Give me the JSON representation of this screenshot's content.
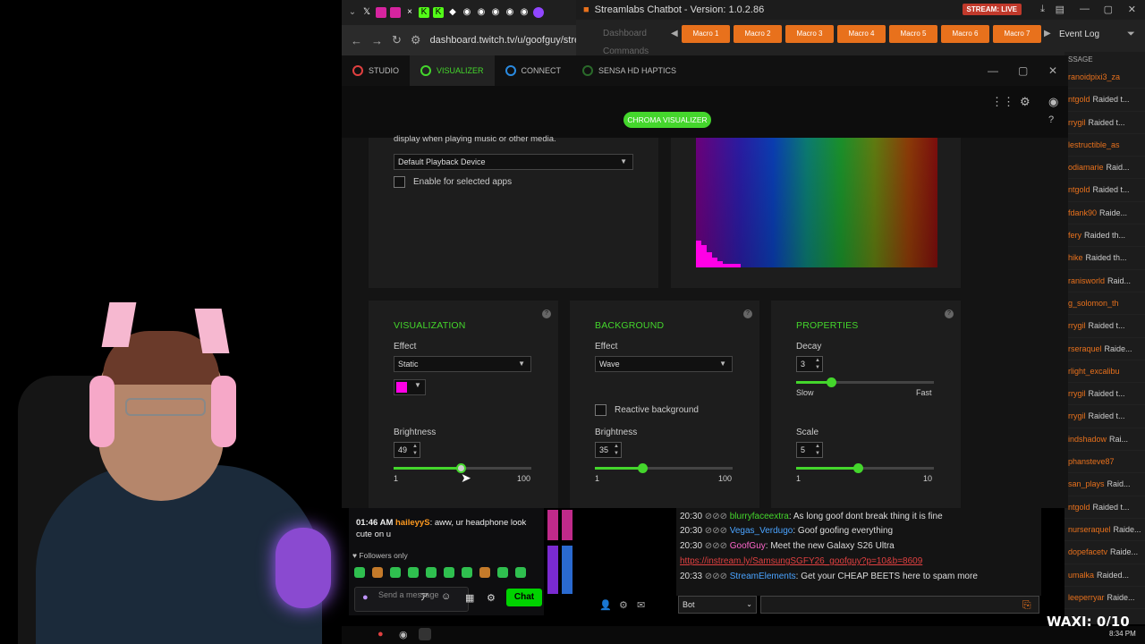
{
  "browser": {
    "url": "dashboard.twitch.tv/u/goofguy/stre"
  },
  "chatbot": {
    "title": "Streamlabs Chatbot - Version: 1.0.2.86",
    "live_badge": "STREAM: LIVE",
    "nav": [
      "Dashboard",
      "Commands"
    ],
    "macros": [
      "Macro 1",
      "Macro 2",
      "Macro 3",
      "Macro 4",
      "Macro 5",
      "Macro 6",
      "Macro 7"
    ],
    "event_log_label": "Event Log",
    "event_header": "SSAGE",
    "events": [
      {
        "name": "ranoidpixi3_za",
        "text": ""
      },
      {
        "name": "ntgold",
        "text": "Raided t..."
      },
      {
        "name": "rrygil",
        "text": "Raided t..."
      },
      {
        "name": "lestructible_as",
        "text": ""
      },
      {
        "name": "odiamarie",
        "text": "Raid..."
      },
      {
        "name": "ntgold",
        "text": "Raided t..."
      },
      {
        "name": "fdank90",
        "text": "Raide..."
      },
      {
        "name": "fery",
        "text": "Raided th..."
      },
      {
        "name": "hike",
        "text": "Raided th..."
      },
      {
        "name": "ranisworld",
        "text": "Raid..."
      },
      {
        "name": "g_solomon_th",
        "text": ""
      },
      {
        "name": "rrygil",
        "text": "Raided t..."
      },
      {
        "name": "rseraquel",
        "text": "Raide..."
      },
      {
        "name": "rlight_excalibu",
        "text": ""
      },
      {
        "name": "rrygil",
        "text": "Raided t..."
      },
      {
        "name": "rrygil",
        "text": "Raided t..."
      },
      {
        "name": "indshadow",
        "text": "Rai..."
      },
      {
        "name": "phansteve87",
        "text": ""
      },
      {
        "name": "san_plays",
        "text": "Raid..."
      },
      {
        "name": "ntgold",
        "text": "Raided t..."
      },
      {
        "name": "nurseraquel",
        "text": "Raide..."
      },
      {
        "name": "dopefacetv",
        "text": "Raide..."
      },
      {
        "name": "umalka",
        "text": "Raided..."
      },
      {
        "name": "leeperryar",
        "text": "Raide..."
      }
    ]
  },
  "synapse": {
    "tabs": [
      "STUDIO",
      "VISUALIZER",
      "CONNECT",
      "SENSA HD HAPTICS"
    ],
    "active_tab": "VISUALIZER",
    "chroma_button": "CHROMA VISUALIZER",
    "intro_text": "display when playing music or other media.",
    "device_select": "Default Playback Device",
    "enable_selected_apps": "Enable for selected apps",
    "visualization": {
      "title": "VISUALIZATION",
      "effect_label": "Effect",
      "effect_value": "Static",
      "color": "#ff00e6",
      "brightness_label": "Brightness",
      "brightness_value": "49",
      "brightness_level": 49,
      "min": "1",
      "max": "100"
    },
    "background": {
      "title": "BACKGROUND",
      "effect_label": "Effect",
      "effect_value": "Wave",
      "reactive_label": "Reactive background",
      "brightness_label": "Brightness",
      "brightness_value": "35",
      "brightness_level": 35,
      "min": "1",
      "max": "100"
    },
    "properties": {
      "title": "PROPERTIES",
      "decay_label": "Decay",
      "decay_value": "3",
      "decay_level": 0.25,
      "slow_label": "Slow",
      "fast_label": "Fast",
      "scale_label": "Scale",
      "scale_value": "5",
      "scale_level": 0.45,
      "min": "1",
      "max": "10"
    },
    "accent_color": "#44d62c"
  },
  "twitch_chat": {
    "time": "01:46 AM",
    "user": "haileyyS",
    "message": ": aww, ur headphone look cute on u",
    "followers_only": "Followers only",
    "input_placeholder": "Send a message",
    "chat_button": "Chat"
  },
  "streamlabs_chat": {
    "rows": [
      {
        "time": "20:30",
        "user": "blurryfaceextra",
        "text": ": As long goof dont break thing it is fine",
        "color": "#44d62c"
      },
      {
        "time": "20:30",
        "user": "Vegas_Verdugo",
        "text": ":  Goof goofing everything",
        "color": "#4aa3ff"
      },
      {
        "time": "20:30",
        "user": "GoofGuy",
        "text": ": Meet the new Galaxy S26 Ultra",
        "color": "#ff66cc"
      },
      {
        "time": "",
        "user": "",
        "text": "https://instream.ly/SamsungSGFY26_goofguy?p=10&b=8609",
        "color": "#e04040"
      },
      {
        "time": "20:33",
        "user": "StreamElements",
        "text": ": Get your CHEAP BEETS here to spam more",
        "color": "#4aa3ff"
      }
    ],
    "bot_select": "Bot"
  },
  "overlay": {
    "score": "WAXI: 0/10"
  },
  "taskbar": {
    "time": "8:34 PM"
  }
}
